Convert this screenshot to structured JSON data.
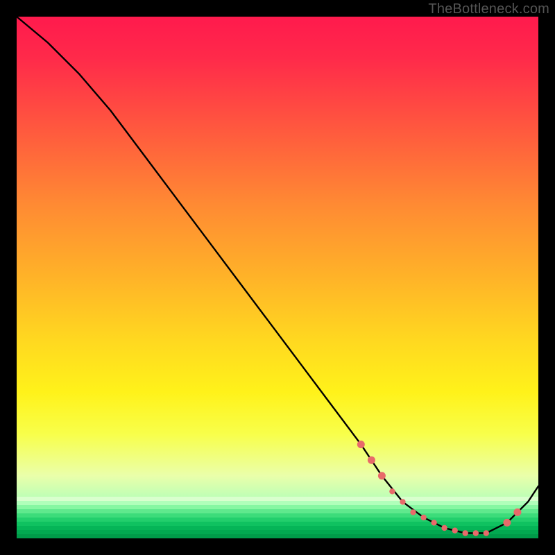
{
  "watermark": "TheBottleneck.com",
  "chart_data": {
    "type": "line",
    "title": "",
    "xlabel": "",
    "ylabel": "",
    "xlim": [
      0,
      100
    ],
    "ylim": [
      0,
      100
    ],
    "grid": false,
    "legend": false,
    "series": [
      {
        "name": "curve",
        "x": [
          0,
          6,
          12,
          18,
          24,
          30,
          36,
          42,
          48,
          54,
          60,
          66,
          70,
          74,
          78,
          82,
          86,
          90,
          94,
          98,
          100
        ],
        "values": [
          100,
          95,
          89,
          82,
          74,
          66,
          58,
          50,
          42,
          34,
          26,
          18,
          12,
          7,
          4,
          2,
          1,
          1,
          3,
          7,
          10
        ]
      }
    ],
    "markers": {
      "name": "highlight-points",
      "color": "#e86a6a",
      "x": [
        66,
        68,
        70,
        72,
        74,
        76,
        78,
        80,
        82,
        84,
        86,
        88,
        90,
        94,
        96
      ],
      "values": [
        18,
        15,
        12,
        9,
        7,
        5,
        4,
        3,
        2,
        1.5,
        1,
        1,
        1,
        3,
        5
      ]
    }
  }
}
